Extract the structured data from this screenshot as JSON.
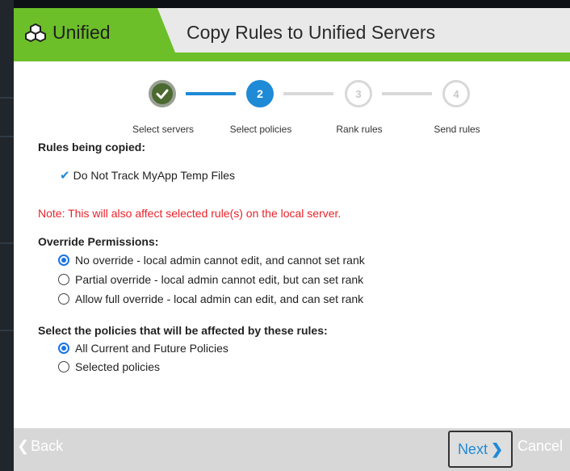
{
  "header": {
    "brand_icon": "cubes-icon",
    "brand": "Unified",
    "title": "Copy Rules to Unified Servers"
  },
  "steps": [
    {
      "number": "",
      "label": "Select servers",
      "state": "done"
    },
    {
      "number": "2",
      "label": "Select policies",
      "state": "active"
    },
    {
      "number": "3",
      "label": "Rank rules",
      "state": "todo"
    },
    {
      "number": "4",
      "label": "Send rules",
      "state": "todo"
    }
  ],
  "rules_section": {
    "label": "Rules being copied:",
    "items": [
      "Do Not Track MyApp Temp Files"
    ]
  },
  "note": "Note: This will also affect selected rule(s) on the local server.",
  "override": {
    "label": "Override Permissions:",
    "options": [
      "No override - local admin cannot edit, and cannot set rank",
      "Partial override - local admin cannot edit, but can set rank",
      "Allow full override - local admin can edit, and can set rank"
    ],
    "selected_index": 0
  },
  "policies": {
    "label": "Select the policies that will be affected by these rules:",
    "options": [
      "All Current and Future Policies",
      "Selected policies"
    ],
    "selected_index": 0
  },
  "footer": {
    "back": "Back",
    "next": "Next",
    "cancel": "Cancel"
  },
  "colors": {
    "accent_green": "#6cbf29",
    "accent_blue": "#1f8ad6",
    "note_red": "#e8232b"
  }
}
